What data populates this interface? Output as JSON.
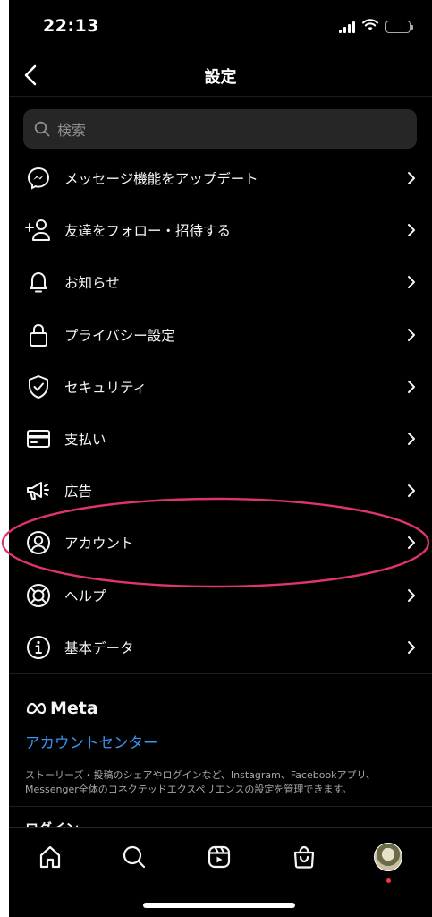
{
  "status_bar": {
    "time": "22:13"
  },
  "header": {
    "title": "設定"
  },
  "search": {
    "placeholder": "検索"
  },
  "settings": {
    "items": [
      {
        "label": "メッセージ機能をアップデート",
        "icon": "messenger-icon"
      },
      {
        "label": "友達をフォロー・招待する",
        "icon": "add-person-icon"
      },
      {
        "label": "お知らせ",
        "icon": "bell-icon"
      },
      {
        "label": "プライバシー設定",
        "icon": "lock-icon"
      },
      {
        "label": "セキュリティ",
        "icon": "shield-check-icon"
      },
      {
        "label": "支払い",
        "icon": "credit-card-icon"
      },
      {
        "label": "広告",
        "icon": "megaphone-icon"
      },
      {
        "label": "アカウント",
        "icon": "account-circle-icon"
      },
      {
        "label": "ヘルプ",
        "icon": "lifebuoy-icon"
      },
      {
        "label": "基本データ",
        "icon": "info-icon"
      }
    ]
  },
  "meta": {
    "logo_text": "Meta",
    "account_center_link": "アカウントセンター",
    "description": "ストーリーズ・投稿のシェアやログインなど、Instagram、Facebookアプリ、Messenger全体のコネクテッドエクスペリエンスの設定を管理できます。"
  },
  "next_section": {
    "heading": "ログイン"
  },
  "tab_bar": {
    "tabs": [
      "home-icon",
      "search-icon",
      "reels-icon",
      "shop-icon",
      "profile-avatar"
    ]
  },
  "colors": {
    "background": "#000000",
    "link": "#3897f0",
    "highlight": "#e0356b",
    "notification_dot": "#ff3040"
  }
}
